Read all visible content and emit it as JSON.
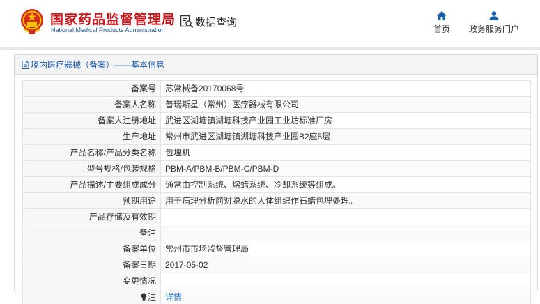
{
  "header": {
    "brand_cn": "国家药品监督管理局",
    "brand_en": "National Medical Products Administration",
    "query_label": "数据查询",
    "nav": [
      {
        "label": "首页",
        "icon": "home-icon"
      },
      {
        "label": "政务服务门户",
        "icon": "user-icon"
      }
    ]
  },
  "panel": {
    "title": "境内医疗器械（备案）——基本信息",
    "rows": [
      {
        "label": "备案号",
        "value": "苏常械备20170068号"
      },
      {
        "label": "备案人名称",
        "value": "普瑞斯星（常州）医疗器械有限公司"
      },
      {
        "label": "备案人注册地址",
        "value": "武进区湖塘镇湖塘科技产业园工业坊标准厂房"
      },
      {
        "label": "生产地址",
        "value": "常州市武进区湖塘镇湖塘科技产业园B2座5层"
      },
      {
        "label": "产品名称/产品分类名称",
        "value": "包埋机"
      },
      {
        "label": "型号规格/包装规格",
        "value": "PBM-A/PBM-B/PBM-C/PBM-D"
      },
      {
        "label": "产品描述/主要组成成分",
        "value": "通常由控制系统、熔蜡系统、冷却系统等组成。"
      },
      {
        "label": "预期用途",
        "value": "用于病理分析前对脱水的人体组织作石蜡包埋处理。"
      },
      {
        "label": "产品存储及有效期",
        "value": ""
      },
      {
        "label": "备注",
        "value": ""
      },
      {
        "label": "备案单位",
        "value": "常州市市场监督管理局"
      },
      {
        "label": "备案日期",
        "value": "2017-05-02"
      },
      {
        "label": "变更情况",
        "value": ""
      }
    ],
    "note_label": "注",
    "note_link": "详情"
  },
  "colors": {
    "brand_red": "#c8161d",
    "brand_blue": "#1b4e8f",
    "link_blue": "#1e73c8",
    "nav_icon_blue": "#1b5fa8"
  }
}
